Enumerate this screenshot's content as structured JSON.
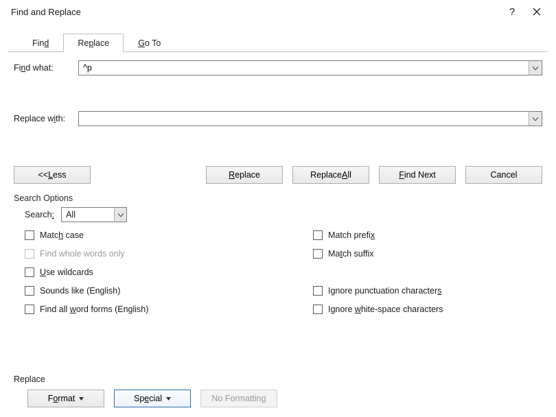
{
  "title": "Find and Replace",
  "tabs": {
    "find": "Find",
    "replace": "Replace",
    "goto": "Go To"
  },
  "fields": {
    "find_label_pre": "Fi",
    "find_label_ul": "n",
    "find_label_post": "d what:",
    "find_value": "^p",
    "replace_label_pre": "Replace w",
    "replace_label_ul": "i",
    "replace_label_post": "th:",
    "replace_value": ""
  },
  "buttons": {
    "less_pre": "<< ",
    "less_ul": "L",
    "less_post": "ess",
    "replace_ul": "R",
    "replace_post": "eplace",
    "replace_all_pre": "Replace ",
    "replace_all_ul": "A",
    "replace_all_post": "ll",
    "find_next_ul": "F",
    "find_next_post": "ind Next",
    "cancel": "Cancel"
  },
  "search_options": {
    "heading": "Search Options",
    "search_label": "Search:",
    "search_value": "All",
    "match_case_pre": "Matc",
    "match_case_ul": "h",
    "match_case_post": " case",
    "whole_words": "Find whole words only",
    "wildcards_ul": "U",
    "wildcards_post": "se wildcards",
    "sounds_like": "Sounds like (English)",
    "word_forms_pre": "Find all ",
    "word_forms_ul": "w",
    "word_forms_post": "ord forms (English)",
    "prefix_pre": "Match prefi",
    "prefix_ul": "x",
    "suffix_pre": "Ma",
    "suffix_ul": "t",
    "suffix_post": "ch suffix",
    "punct_pre": "Ignore punctuation character",
    "punct_ul": "s",
    "white_pre": "Ignore ",
    "white_ul": "w",
    "white_post": "hite-space characters"
  },
  "bottom": {
    "heading": "Replace",
    "format_pre": "F",
    "format_ul": "o",
    "format_post": "rmat",
    "special_pre": "Sp",
    "special_ul": "e",
    "special_post": "cial",
    "no_formatting": "No Formatting"
  }
}
